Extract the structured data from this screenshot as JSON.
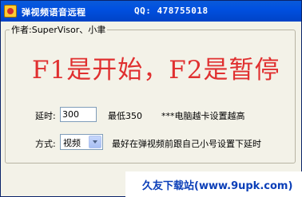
{
  "window": {
    "title": "弹视频语音远程",
    "qq": "QQ: 478755018"
  },
  "group": {
    "legend": "作者:SuperVisor、小聿"
  },
  "headline": "F1是开始，F2是暂停",
  "delay": {
    "label": "延时:",
    "value": "300",
    "min_note": "最低350",
    "hint": "***电脑越卡设置越高"
  },
  "mode": {
    "label": "方式:",
    "selected": "视频",
    "hint": "最好在弹视频前跟自己小号设置下延时"
  },
  "watermark": "久友下载站(www.9upk.com)",
  "colors": {
    "headline": "#e03030",
    "titlebar": "#0050e0",
    "watermark": "#0b3fb8"
  }
}
